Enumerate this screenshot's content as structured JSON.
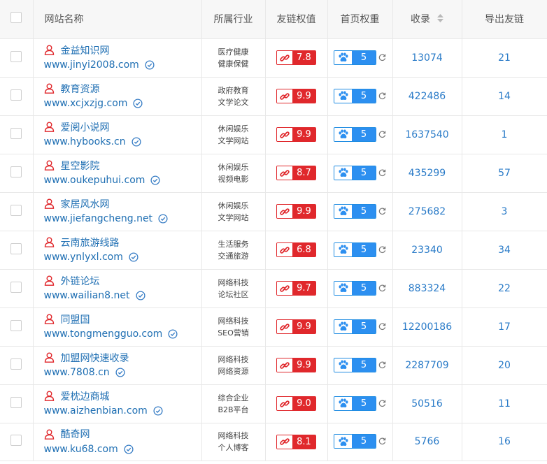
{
  "header": {
    "site_name": "网站名称",
    "industry": "所属行业",
    "link_weight": "友链权值",
    "home_weight": "首页权重",
    "indexed": "收录",
    "outbound_links": "导出友链"
  },
  "colors": {
    "link_badge_red": "#e0282c",
    "baidu_blue": "#2c8ff0",
    "link_text_blue": "#1f6fb3"
  },
  "rows": [
    {
      "name": "金益知识网",
      "url": "www.jinyi2008.com",
      "industry": [
        "医疗健康",
        "健康保健"
      ],
      "link_weight": "7.8",
      "home_weight": "5",
      "indexed": "13074",
      "outbound": "21"
    },
    {
      "name": "教育资源",
      "url": "www.xcjxzjg.com",
      "industry": [
        "政府教育",
        "文学论文"
      ],
      "link_weight": "9.9",
      "home_weight": "5",
      "indexed": "422486",
      "outbound": "14"
    },
    {
      "name": "爱阅小说网",
      "url": "www.hybooks.cn",
      "industry": [
        "休闲娱乐",
        "文学网站"
      ],
      "link_weight": "9.9",
      "home_weight": "5",
      "indexed": "1637540",
      "outbound": "1"
    },
    {
      "name": "星空影院",
      "url": "www.oukepuhui.com",
      "industry": [
        "休闲娱乐",
        "视频电影"
      ],
      "link_weight": "8.7",
      "home_weight": "5",
      "indexed": "435299",
      "outbound": "57"
    },
    {
      "name": "家居风水网",
      "url": "www.jiefangcheng.net",
      "industry": [
        "休闲娱乐",
        "文学网站"
      ],
      "link_weight": "9.9",
      "home_weight": "5",
      "indexed": "275682",
      "outbound": "3"
    },
    {
      "name": "云南旅游线路",
      "url": "www.ynlyxl.com",
      "industry": [
        "生活服务",
        "交通旅游"
      ],
      "link_weight": "6.8",
      "home_weight": "5",
      "indexed": "23340",
      "outbound": "34"
    },
    {
      "name": "外链论坛",
      "url": "www.wailian8.net",
      "industry": [
        "网络科技",
        "论坛社区"
      ],
      "link_weight": "9.7",
      "home_weight": "5",
      "indexed": "883324",
      "outbound": "22"
    },
    {
      "name": "同盟国",
      "url": "www.tongmengguo.com",
      "industry": [
        "网络科技",
        "SEO营销"
      ],
      "link_weight": "9.9",
      "home_weight": "5",
      "indexed": "12200186",
      "outbound": "17"
    },
    {
      "name": "加盟网快速收录",
      "url": "www.7808.cn",
      "industry": [
        "网络科技",
        "网络资源"
      ],
      "link_weight": "9.9",
      "home_weight": "5",
      "indexed": "2287709",
      "outbound": "20"
    },
    {
      "name": "爱枕边商城",
      "url": "www.aizhenbian.com",
      "industry": [
        "综合企业",
        "B2B平台"
      ],
      "link_weight": "9.0",
      "home_weight": "5",
      "indexed": "50516",
      "outbound": "11"
    },
    {
      "name": "酷奇网",
      "url": "www.ku68.com",
      "industry": [
        "网络科技",
        "个人博客"
      ],
      "link_weight": "8.1",
      "home_weight": "5",
      "indexed": "5766",
      "outbound": "16"
    }
  ]
}
